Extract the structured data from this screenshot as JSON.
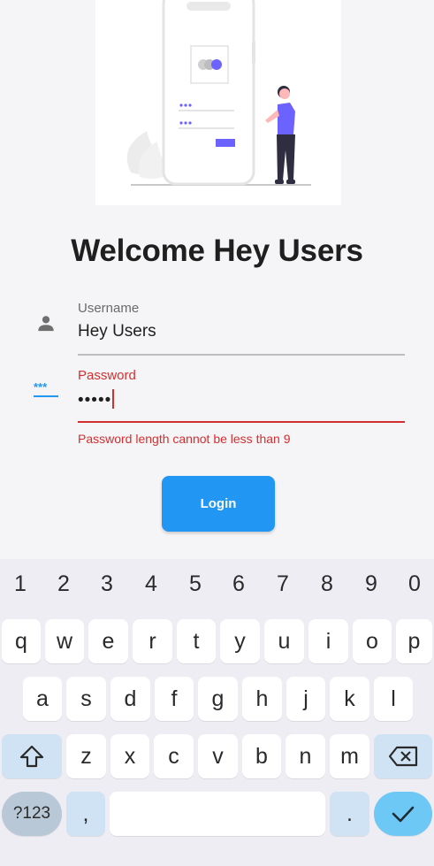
{
  "title": "Welcome Hey Users",
  "illustration": {
    "name": "login-illustration"
  },
  "username": {
    "label": "Username",
    "value": "Hey Users",
    "icon": "person-icon"
  },
  "password": {
    "label": "Password",
    "value": "•••••",
    "icon": "password-icon",
    "error": "Password length cannot be less than 9"
  },
  "login_button": {
    "label": "Login"
  },
  "colors": {
    "accent": "#2196f3",
    "error": "#d32f2f",
    "illustration_accent": "#6c63ff"
  },
  "keyboard": {
    "numbers": [
      "1",
      "2",
      "3",
      "4",
      "5",
      "6",
      "7",
      "8",
      "9",
      "0"
    ],
    "row1": [
      "q",
      "w",
      "e",
      "r",
      "t",
      "y",
      "u",
      "i",
      "o",
      "p"
    ],
    "row2": [
      "a",
      "s",
      "d",
      "f",
      "g",
      "h",
      "j",
      "k",
      "l"
    ],
    "row3": [
      "z",
      "x",
      "c",
      "v",
      "b",
      "n",
      "m"
    ],
    "symbols_label": "?123",
    "comma": ",",
    "period": "."
  }
}
